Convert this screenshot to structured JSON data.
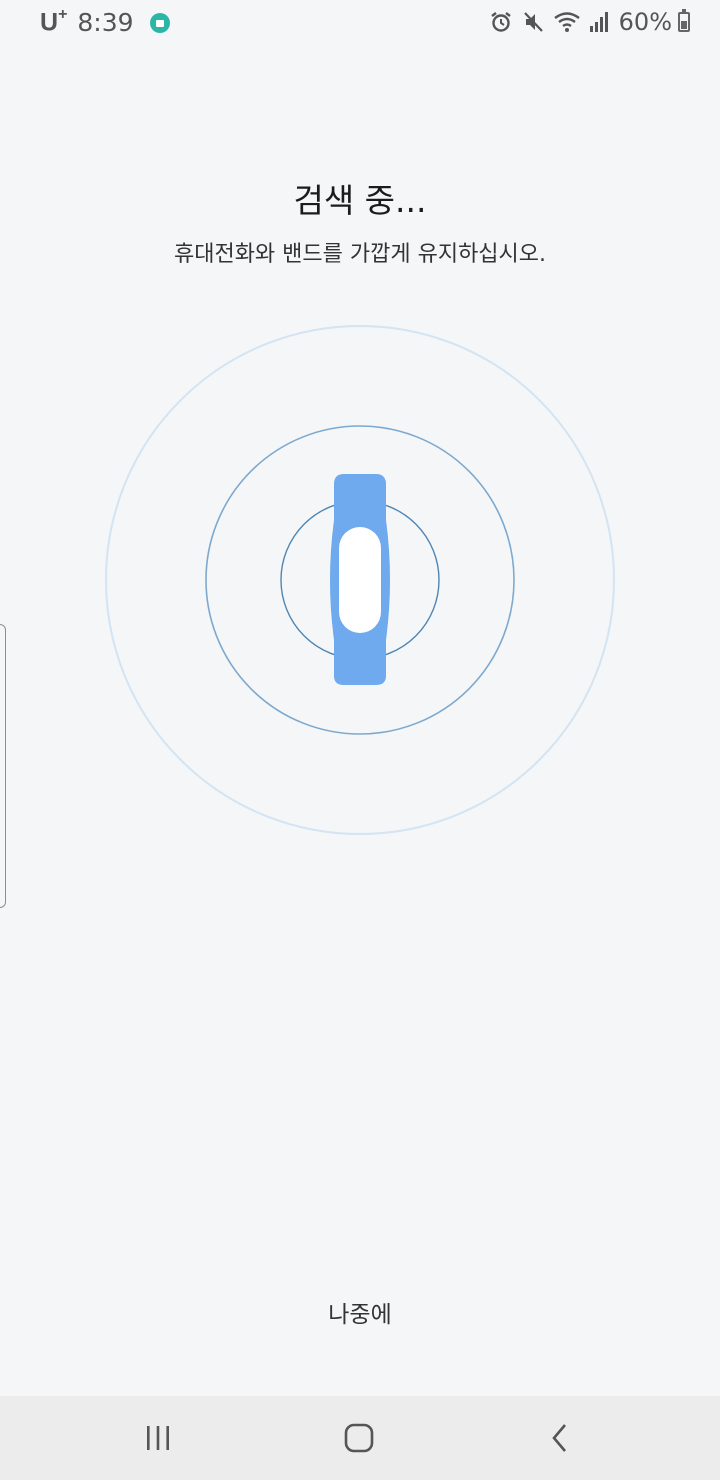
{
  "status_bar": {
    "carrier": "U",
    "carrier_sup": "+",
    "time": "8:39",
    "battery_percent": "60%",
    "battery_level": 0.6,
    "icons": [
      "vpn-icon",
      "alarm-icon",
      "mute-icon",
      "wifi-icon",
      "signal-icon",
      "battery-icon"
    ]
  },
  "main": {
    "title": "검색 중...",
    "subtitle": "휴대전화와 밴드를 가깝게 유지하십시오."
  },
  "graphic": {
    "icon": "band-icon",
    "band_color": "#6eaaed",
    "ring_colors": [
      "#d4e4f2",
      "#7ea9cf",
      "#4f86b4"
    ]
  },
  "actions": {
    "later_label": "나중에"
  },
  "nav_bar": {
    "icons": [
      "recent-apps-icon",
      "home-icon",
      "back-icon"
    ]
  }
}
